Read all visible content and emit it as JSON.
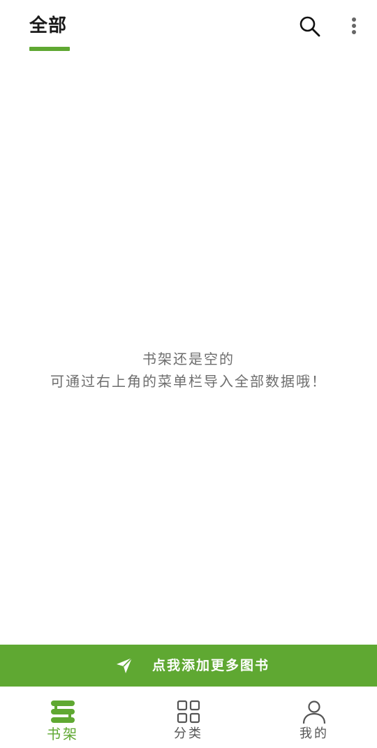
{
  "header": {
    "tab_label": "全部",
    "accent_color": "#5fa832",
    "icons": [
      "search-icon",
      "more-vertical-icon"
    ]
  },
  "empty_state": {
    "line1": "书架还是空的",
    "line2": "可通过右上角的菜单栏导入全部数据哦！"
  },
  "add_banner": {
    "label": "点我添加更多图书",
    "icon": "send-arrow-icon"
  },
  "bottom_nav": {
    "items": [
      {
        "label": "书架",
        "icon": "bookshelf-icon",
        "active": true
      },
      {
        "label": "分类",
        "icon": "grid-icon",
        "active": false
      },
      {
        "label": "我的",
        "icon": "person-icon",
        "active": false
      }
    ]
  }
}
